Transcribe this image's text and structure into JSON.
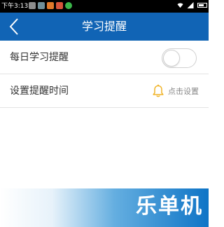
{
  "status_bar": {
    "time": "下午3:13",
    "notification_icons": [
      "app-notification-icon",
      "app-notification-icon",
      "app-notification-icon",
      "app-notification-icon",
      "app-notification-icon"
    ]
  },
  "header": {
    "back_icon": "chevron-left-icon",
    "title": "学习提醒"
  },
  "settings": {
    "daily_reminder": {
      "label": "每日学习提醒",
      "enabled": false
    },
    "reminder_time": {
      "label": "设置提醒时间",
      "icon": "bell-icon",
      "action_label": "点击设置"
    }
  },
  "colors": {
    "header": "#1164b5",
    "bell": "#f0b429",
    "watermark_blue": "#0e74c6"
  },
  "watermark": {
    "text": "乐单机"
  }
}
